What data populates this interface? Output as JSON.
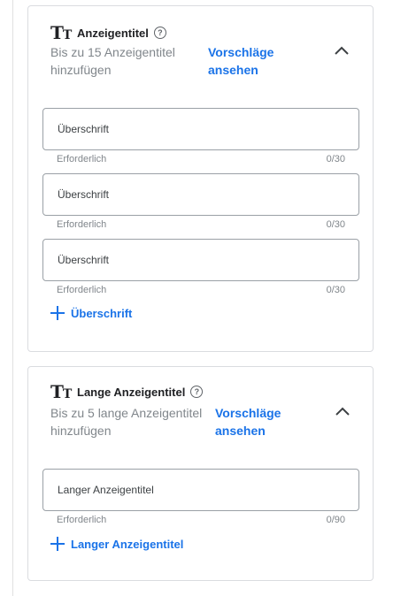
{
  "sections": [
    {
      "title": "Anzeigentitel",
      "subtitle": "Bis zu 15 Anzeigentitel hinzufügen",
      "suggest_link": "Vorschläge ansehen",
      "fields": [
        {
          "placeholder": "Überschrift",
          "helper": "Erforderlich",
          "counter": "0/30"
        },
        {
          "placeholder": "Überschrift",
          "helper": "Erforderlich",
          "counter": "0/30"
        },
        {
          "placeholder": "Überschrift",
          "helper": "Erforderlich",
          "counter": "0/30"
        }
      ],
      "add_label": "Überschrift"
    },
    {
      "title": "Lange Anzeigentitel",
      "subtitle": "Bis zu 5 lange Anzeigentitel hinzufügen",
      "suggest_link": "Vorschläge ansehen",
      "fields": [
        {
          "placeholder": "Langer Anzeigentitel",
          "helper": "Erforderlich",
          "counter": "0/90"
        }
      ],
      "add_label": "Langer Anzeigentitel"
    }
  ],
  "icons": {
    "title_icon": "text-size-icon",
    "help_icon": "help-circle-icon",
    "collapse_icon": "chevron-up-icon",
    "add_icon": "plus-icon"
  },
  "colors": {
    "accent": "#1a73e8",
    "muted_text": "#80868b",
    "border": "#dadce0"
  }
}
